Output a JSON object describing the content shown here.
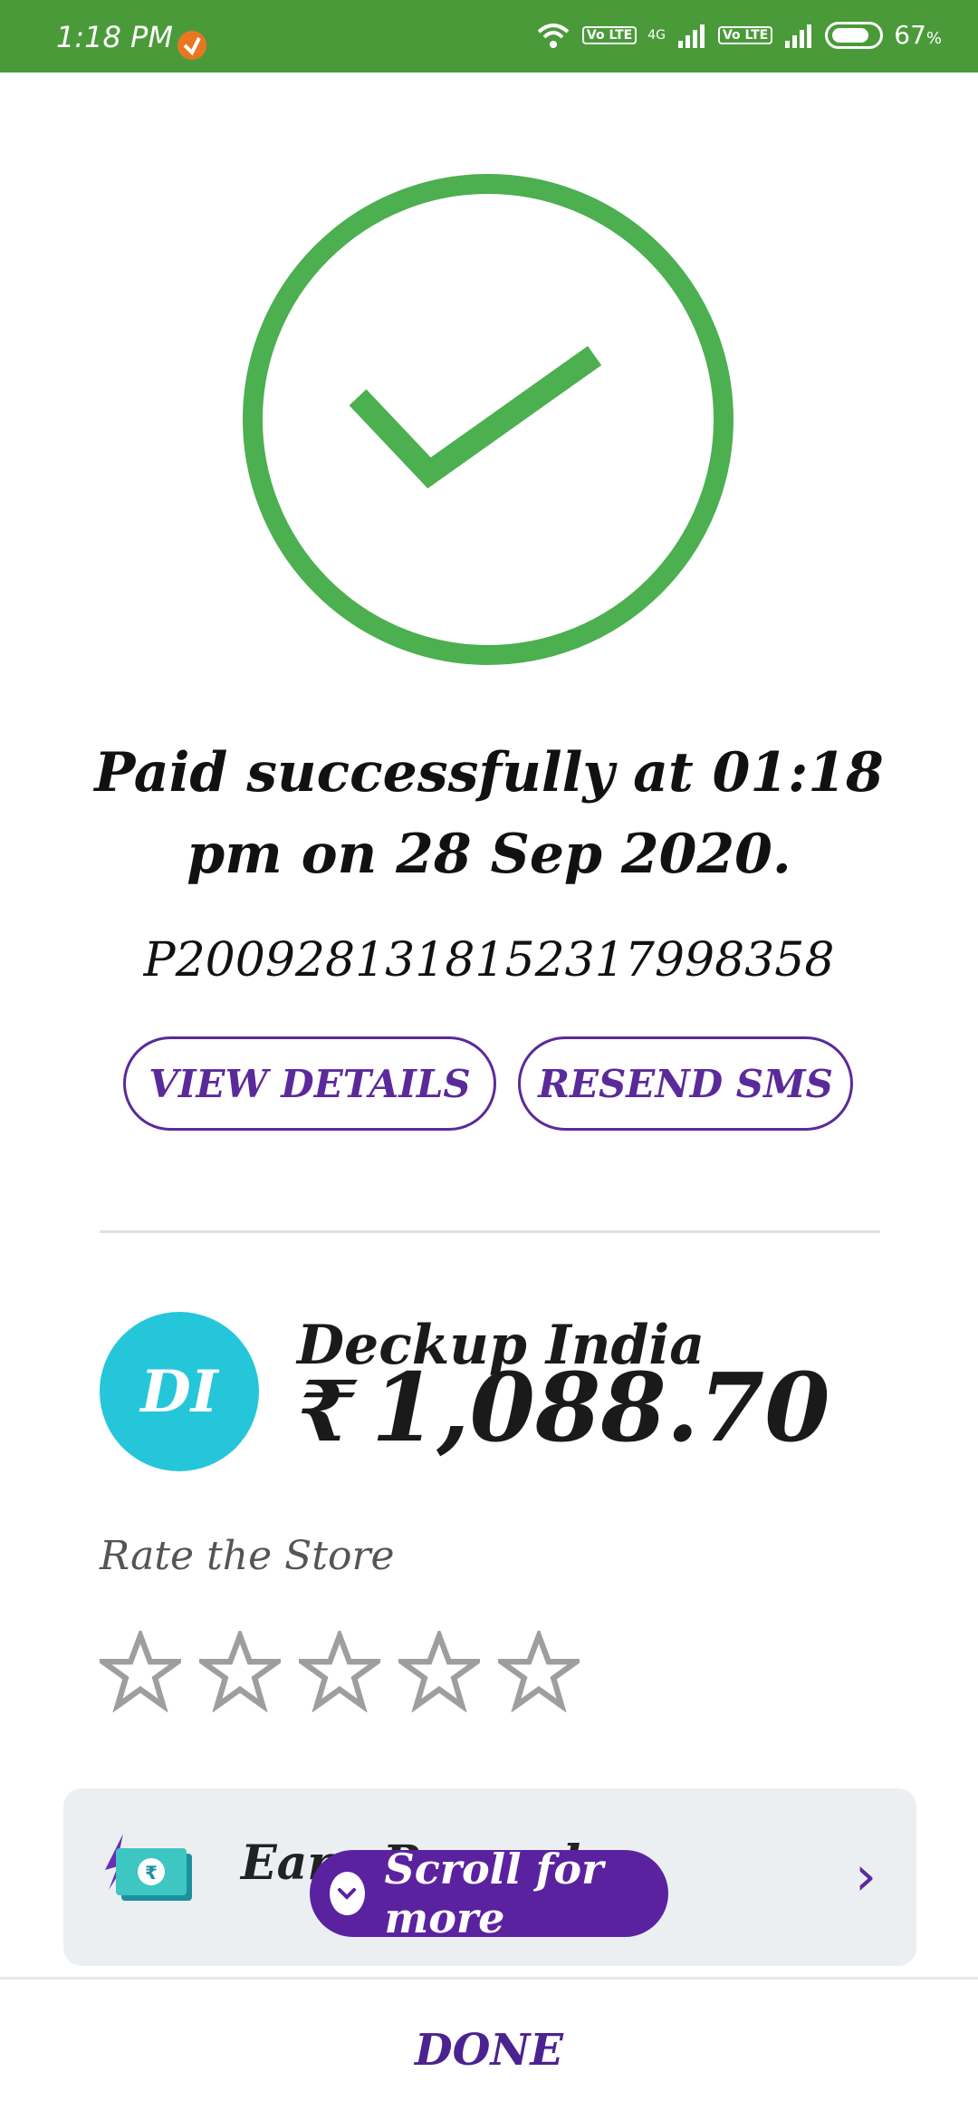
{
  "status_bar": {
    "time": "1:18 PM",
    "battery": "67",
    "battery_unit": "%",
    "network_badge_1": "Vo LTE",
    "network_badge_2": "Vo LTE",
    "network_type": "4G"
  },
  "payment": {
    "status_text": "Paid successfully at 01:18 pm on 28 Sep 2020.",
    "transaction_id": "P2009281318152317998358",
    "view_details_label": "VIEW DETAILS",
    "resend_sms_label": "RESEND SMS"
  },
  "store": {
    "avatar_initials": "DI",
    "name": "Deckup India",
    "currency_symbol": "₹",
    "amount": "1,088.70",
    "rate_label": "Rate the Store",
    "rating": 0,
    "max_rating": 5
  },
  "earn_card": {
    "text": "Earn Rewards",
    "icon": "cash-rupee-icon"
  },
  "scroll_hint": {
    "label": "Scroll for more"
  },
  "footer": {
    "done_label": "DONE"
  },
  "colors": {
    "status_bar": "#4a9a3a",
    "success_green": "#4caf50",
    "primary_purple": "#5b2a9a",
    "avatar_bg": "#26c6da"
  }
}
